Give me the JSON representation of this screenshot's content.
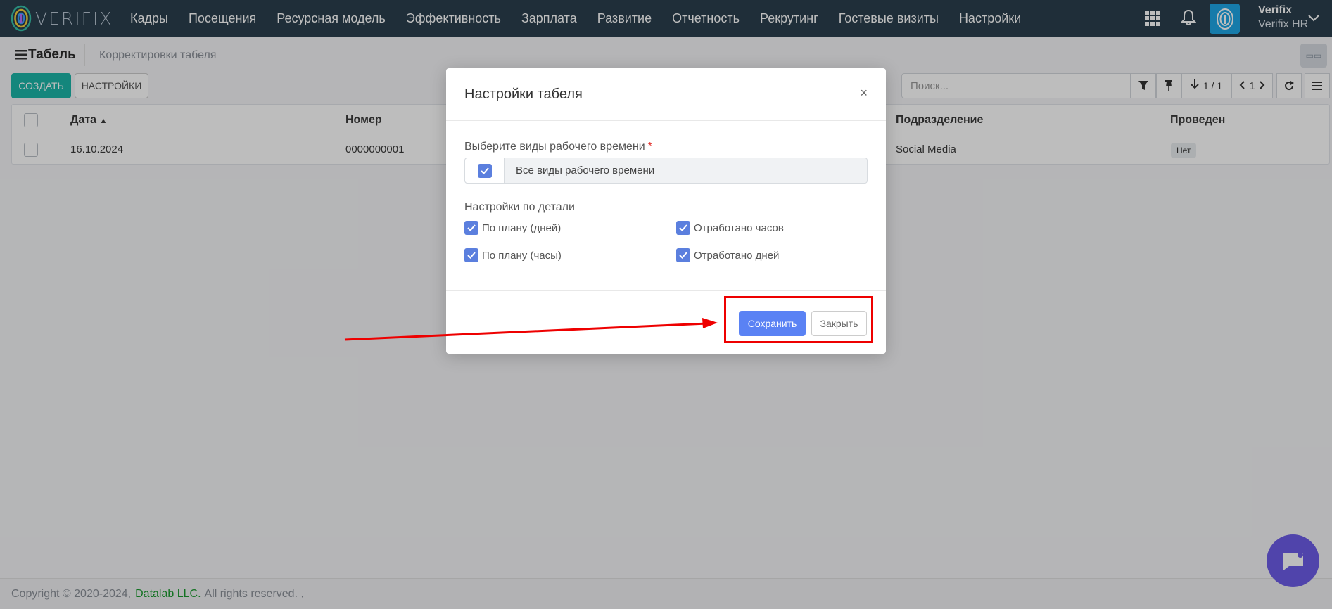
{
  "nav": {
    "logo_text": "VERIFIX",
    "items": [
      {
        "label": "Кадры"
      },
      {
        "label": "Посещения"
      },
      {
        "label": "Ресурсная модель"
      },
      {
        "label": "Эффективность"
      },
      {
        "label": "Зарплата"
      },
      {
        "label": "Развитие"
      },
      {
        "label": "Отчетность"
      },
      {
        "label": "Рекрутинг"
      },
      {
        "label": "Гостевые визиты"
      },
      {
        "label": "Настройки"
      }
    ],
    "user_name": "Verifix",
    "user_org": "Verifix HR",
    "bg_color": "#2a3f4e"
  },
  "page": {
    "title": "Табель",
    "breadcrumb": "Корректировки табеля",
    "create_label": "СОЗДАТЬ",
    "settings_label": "НАСТРОЙКИ",
    "search_placeholder": "Поиск...",
    "pager_text": "1 / 1",
    "page_number": "1"
  },
  "table": {
    "columns": [
      "Дата",
      "Номер",
      "Подразделение",
      "Проведен"
    ],
    "rows": [
      {
        "date": "16.10.2024",
        "number": "0000000001",
        "division": "Social Media",
        "posted": "Нет"
      }
    ]
  },
  "modal": {
    "title": "Настройки табеля",
    "close_glyph": "×",
    "field_label": "Выберите виды рабочего времени",
    "required_mark": "*",
    "select_value": "Все виды рабочего времени",
    "section_label": "Настройки по детали",
    "options": [
      {
        "label": "По плану (дней)",
        "checked": true
      },
      {
        "label": "Отработано часов",
        "checked": true
      },
      {
        "label": "По плану (часы)",
        "checked": true
      },
      {
        "label": "Отработано дней",
        "checked": true
      }
    ],
    "save_label": "Сохранить",
    "close_label": "Закрыть"
  },
  "footer": {
    "copyright": "Copyright © 2020-2024,",
    "company": "Datalab LLC.",
    "rights": "All rights reserved. ,"
  },
  "colors": {
    "accent_teal": "#1bb5a8",
    "primary_blue": "#5a82f4",
    "annotation_red": "#ee0000"
  }
}
